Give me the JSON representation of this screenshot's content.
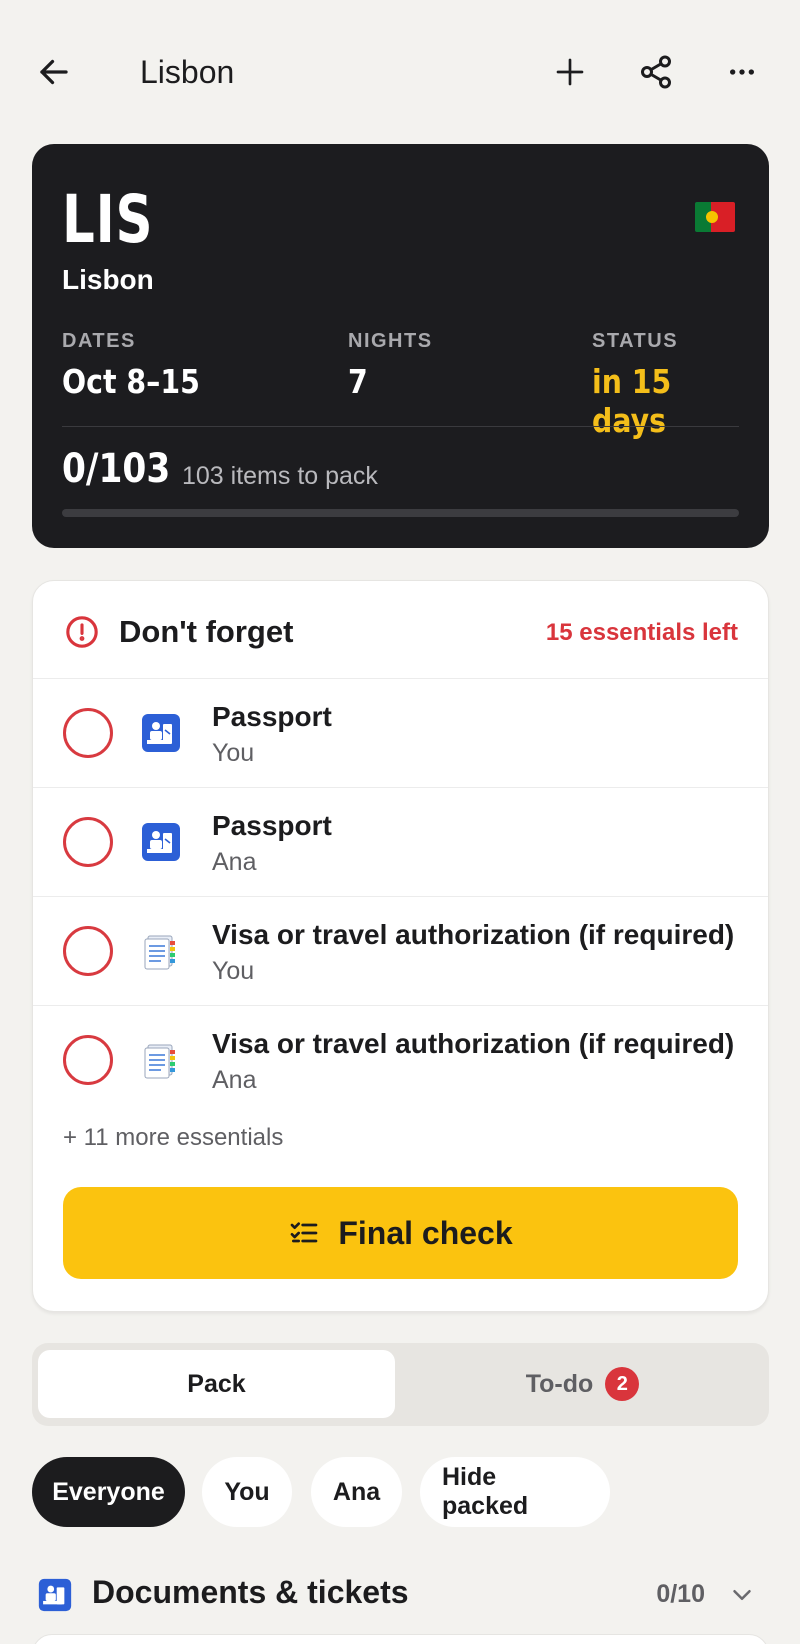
{
  "header": {
    "title": "Lisbon"
  },
  "trip": {
    "code": "LIS",
    "city": "Lisbon",
    "dates_label": "DATES",
    "dates_value": "Oct 8–15",
    "nights_label": "NIGHTS",
    "nights_value": "7",
    "status_label": "STATUS",
    "status_value": "in 15 days",
    "packed_count": "0/103",
    "packed_sub": "103 items to pack",
    "packed_progress": 0,
    "flag": "portugal-flag"
  },
  "forget": {
    "title": "Don't forget",
    "essentials_left": "15 essentials left",
    "items": [
      {
        "name": "Passport",
        "who": "You",
        "icon": "passport-control-icon"
      },
      {
        "name": "Passport",
        "who": "Ana",
        "icon": "passport-control-icon"
      },
      {
        "name": "Visa or travel authorization (if required)",
        "who": "You",
        "icon": "document-icon"
      },
      {
        "name": "Visa or travel authorization (if required)",
        "who": "Ana",
        "icon": "document-icon"
      }
    ],
    "more": "+ 11 more essentials",
    "final_check": "Final check"
  },
  "tabs": {
    "pack": "Pack",
    "todo": "To-do",
    "todo_badge": "2"
  },
  "chips": [
    "Everyone",
    "You",
    "Ana",
    "Hide packed"
  ],
  "section": {
    "title": "Documents & tickets",
    "count": "0/10"
  },
  "colors": {
    "accent": "#fbc30f",
    "alert": "#d9353c",
    "card_dark": "#1c1c1f",
    "status": "#f4be1a"
  }
}
